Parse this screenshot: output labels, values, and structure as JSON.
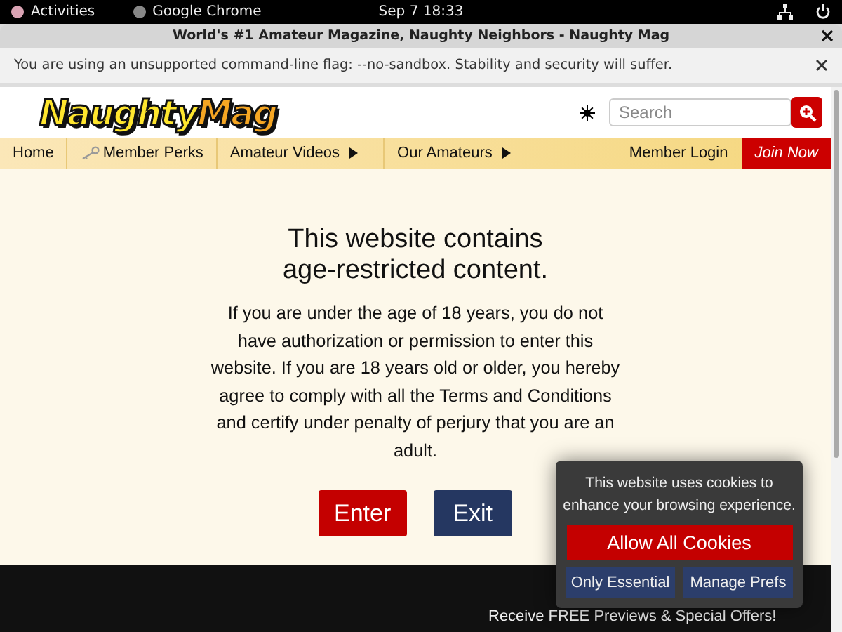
{
  "top_bar": {
    "activities": "Activities",
    "app": "Google Chrome",
    "clock": "Sep 7  18:33"
  },
  "window": {
    "title": "World's #1 Amateur Magazine, Naughty Neighbors - Naughty Mag"
  },
  "infobar": {
    "message": "You are using an unsupported command-line flag: --no-sandbox. Stability and security will suffer."
  },
  "site": {
    "logo": [
      "Naughty",
      "Mag"
    ],
    "search": {
      "placeholder": "Search"
    }
  },
  "nav": {
    "items": [
      {
        "label": "Home",
        "kind": "plain"
      },
      {
        "label": "Member Perks",
        "kind": "key"
      },
      {
        "label": "Amateur Videos",
        "kind": "menu"
      },
      {
        "label": "Our Amateurs",
        "kind": "menu"
      }
    ],
    "login": "Member Login",
    "join": "Join Now"
  },
  "age_gate": {
    "heading": [
      "This website contains",
      "age-restricted content."
    ],
    "body": "If you are under the age of 18 years, you do not have authorization or permission to enter this website. If you are 18 years old or older, you hereby agree to comply with all the Terms and Conditions and certify under penalty of perjury that you are an adult.",
    "buttons": [
      {
        "label": "Enter",
        "kind": "enter"
      },
      {
        "label": "Exit",
        "kind": "exit"
      }
    ]
  },
  "footer": {
    "offer": "Receive FREE Previews & Special Offers!"
  },
  "cookies": {
    "message": "This website uses cookies to enhance your browsing experience.",
    "allow": "Allow All Cookies",
    "buttons": [
      "Only Essential",
      "Manage Prefs"
    ]
  }
}
